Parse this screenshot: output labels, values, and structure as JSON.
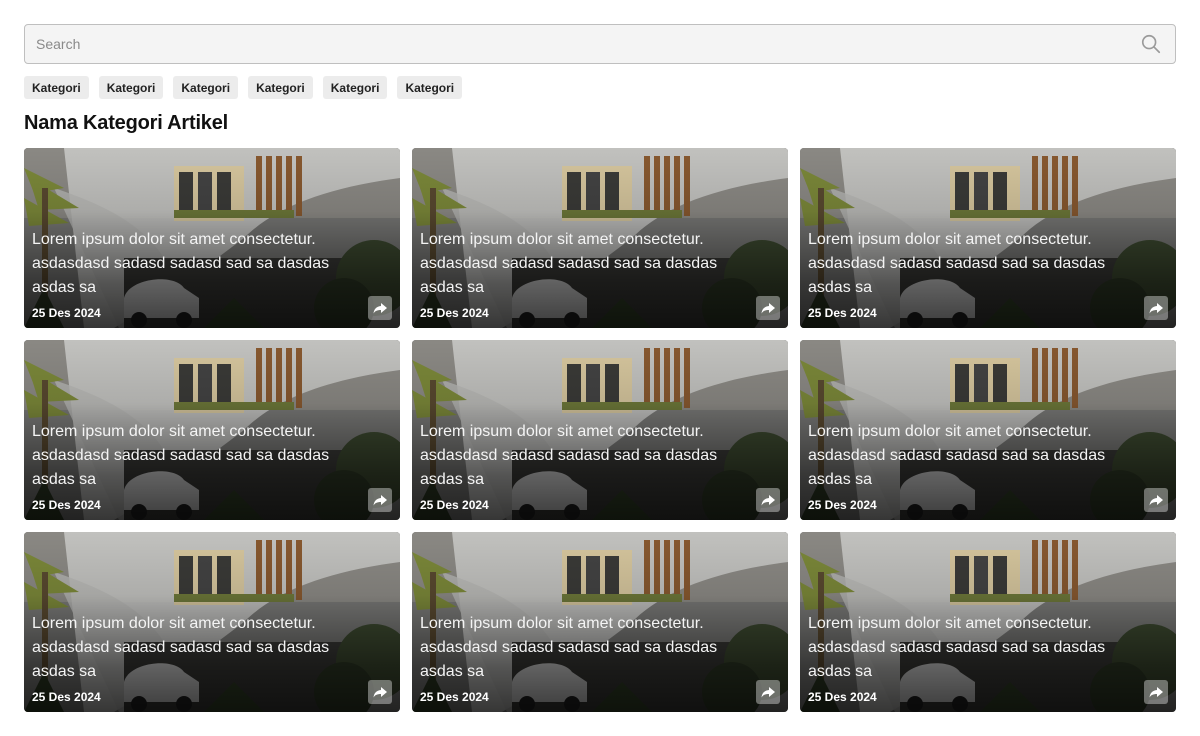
{
  "search": {
    "placeholder": "Search",
    "icon": "search-icon"
  },
  "categories": [
    "Kategori",
    "Kategori",
    "Kategori",
    "Kategori",
    "Kategori",
    "Kategori"
  ],
  "section_title": "Nama Kategori Artikel",
  "articles": [
    {
      "text": "Lorem ipsum dolor sit amet consectetur. asdasdasd sadasd sadasd sad sa dasdas asdas sa",
      "date": "25 Des 2024"
    },
    {
      "text": "Lorem ipsum dolor sit amet consectetur. asdasdasd sadasd sadasd sad sa dasdas asdas sa",
      "date": "25 Des 2024"
    },
    {
      "text": "Lorem ipsum dolor sit amet consectetur. asdasdasd sadasd sadasd sad sa dasdas asdas sa",
      "date": "25 Des 2024"
    },
    {
      "text": "Lorem ipsum dolor sit amet consectetur. asdasdasd sadasd sadasd sad sa dasdas asdas sa",
      "date": "25 Des 2024"
    },
    {
      "text": "Lorem ipsum dolor sit amet consectetur. asdasdasd sadasd sadasd sad sa dasdas asdas sa",
      "date": "25 Des 2024"
    },
    {
      "text": "Lorem ipsum dolor sit amet consectetur. asdasdasd sadasd sadasd sad sa dasdas asdas sa",
      "date": "25 Des 2024"
    },
    {
      "text": "Lorem ipsum dolor sit amet consectetur. asdasdasd sadasd sadasd sad sa dasdas asdas sa",
      "date": "25 Des 2024"
    },
    {
      "text": "Lorem ipsum dolor sit amet consectetur. asdasdasd sadasd sadasd sad sa dasdas asdas sa",
      "date": "25 Des 2024"
    },
    {
      "text": "Lorem ipsum dolor sit amet consectetur. asdasdasd sadasd sadasd sad sa dasdas asdas sa",
      "date": "25 Des 2024"
    }
  ],
  "icons": {
    "share": "share-icon"
  }
}
